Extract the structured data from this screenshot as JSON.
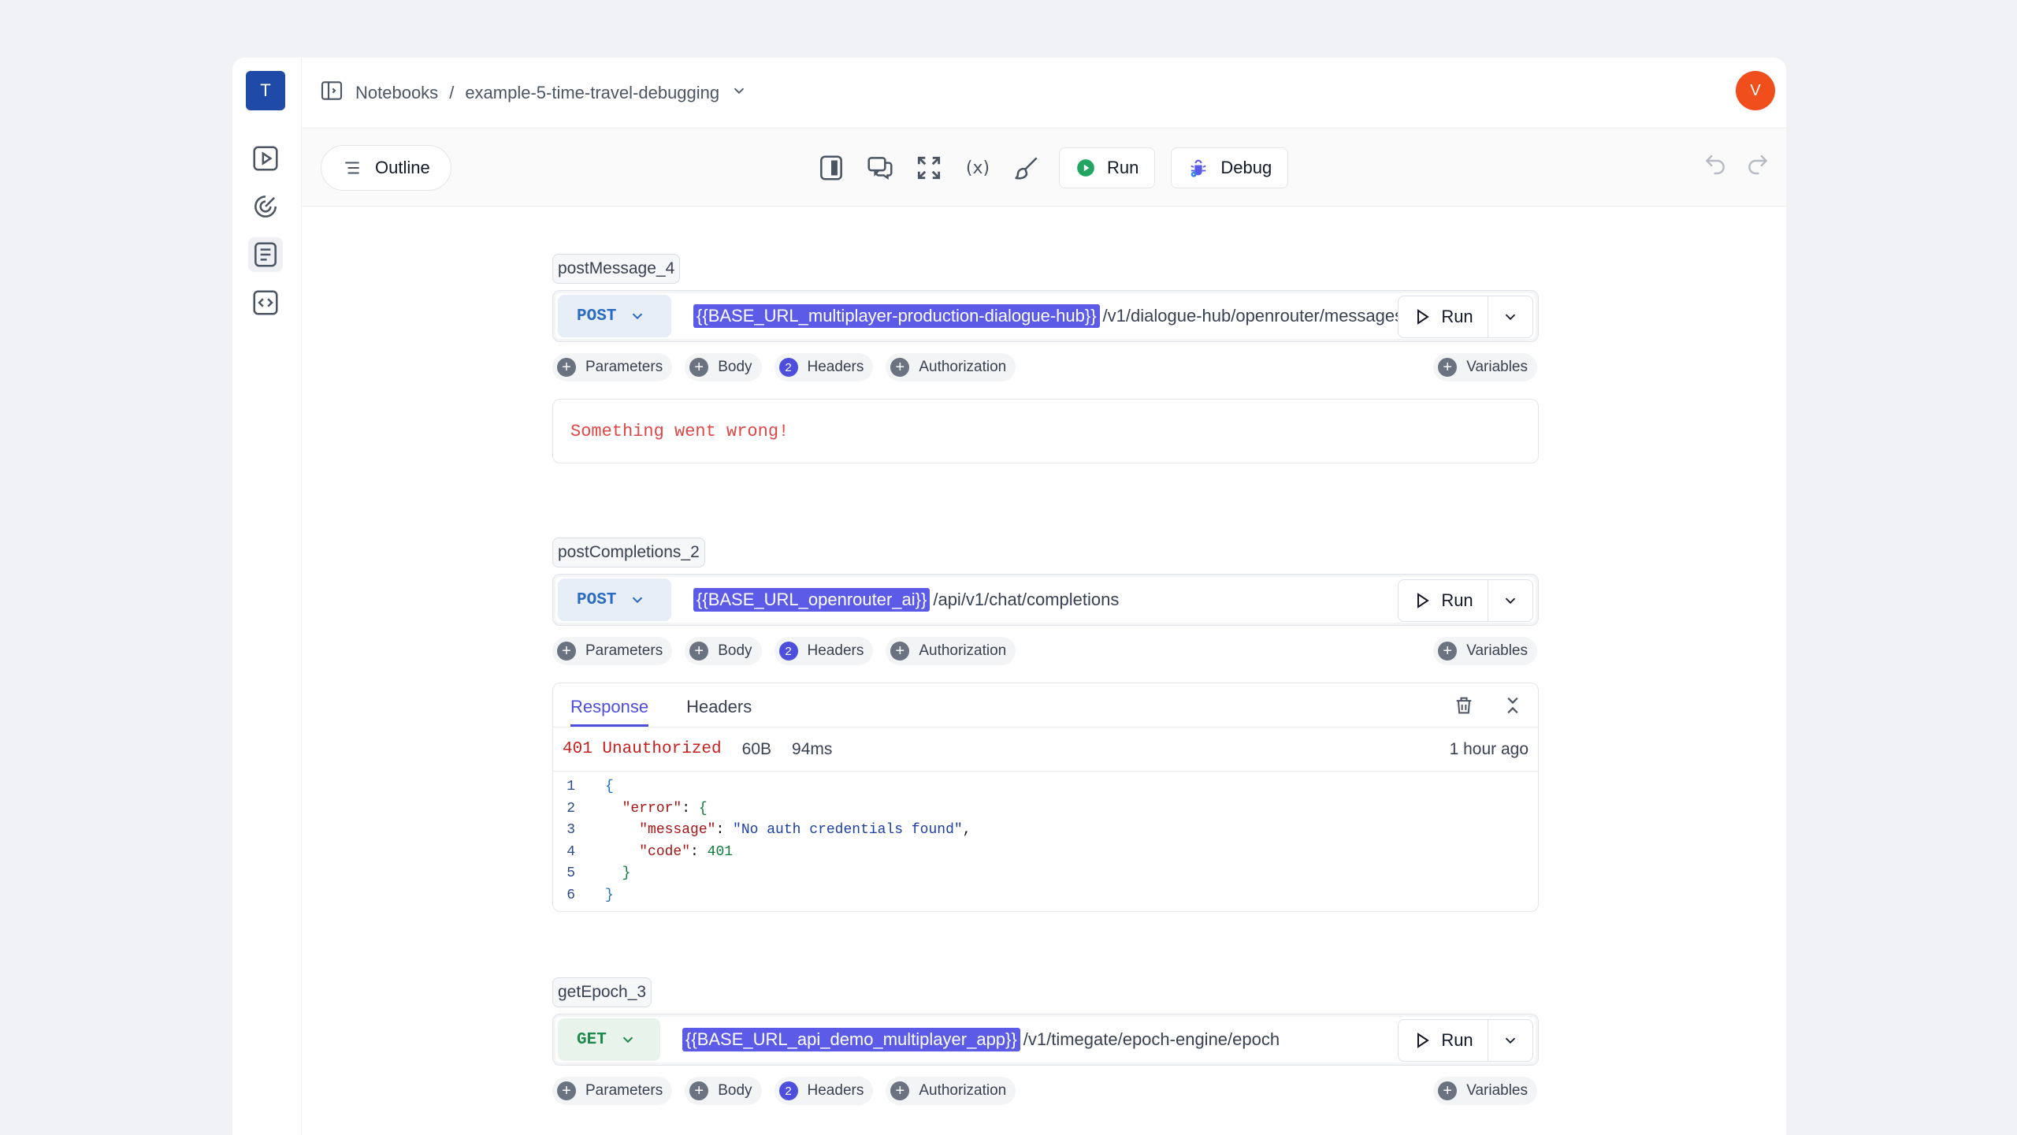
{
  "workspace": {
    "initial": "T"
  },
  "user": {
    "initial": "V"
  },
  "breadcrumb": {
    "root": "Notebooks",
    "separator": "/",
    "current": "example-5-time-travel-debugging"
  },
  "toolbar": {
    "outline_label": "Outline",
    "variables_symbol": "(x)",
    "run_label": "Run",
    "debug_label": "Debug"
  },
  "blocks": [
    {
      "name": "postMessage_4",
      "method": "POST",
      "url_var": "{{BASE_URL_multiplayer-production-dialogue-hub}}",
      "url_path": "/v1/dialogue-hub/openrouter/messages",
      "run_label": "Run",
      "options": {
        "parameters": "Parameters",
        "body": "Body",
        "headers": "Headers",
        "headers_count": "2",
        "authorization": "Authorization",
        "variables": "Variables"
      },
      "error_text": "Something went wrong!"
    },
    {
      "name": "postCompletions_2",
      "method": "POST",
      "url_var": "{{BASE_URL_openrouter_ai}}",
      "url_path": "/api/v1/chat/completions",
      "run_label": "Run",
      "options": {
        "parameters": "Parameters",
        "body": "Body",
        "headers": "Headers",
        "headers_count": "2",
        "authorization": "Authorization",
        "variables": "Variables"
      },
      "response": {
        "tabs": [
          "Response",
          "Headers"
        ],
        "status": "401 Unauthorized",
        "size": "60B",
        "duration": "94ms",
        "time_ago": "1 hour ago",
        "line_numbers": [
          "1",
          "2",
          "3",
          "4",
          "5",
          "6"
        ]
      }
    },
    {
      "name": "getEpoch_3",
      "method": "GET",
      "url_var": "{{BASE_URL_api_demo_multiplayer_app}}",
      "url_path": "/v1/timegate/epoch-engine/epoch",
      "run_label": "Run",
      "options": {
        "parameters": "Parameters",
        "body": "Body",
        "headers": "Headers",
        "headers_count": "2",
        "authorization": "Authorization",
        "variables": "Variables"
      }
    }
  ],
  "colors": {
    "accent": "#4d4dde",
    "variable_chip": "#5b5be8",
    "error": "#e24545",
    "avatar": "#f04e1b",
    "workspace": "#1f4aa8"
  }
}
